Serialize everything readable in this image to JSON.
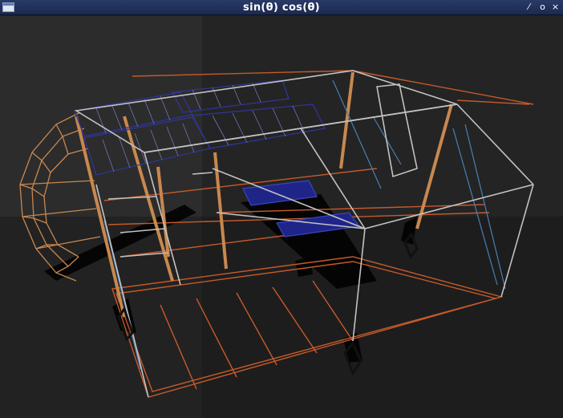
{
  "window": {
    "title": "sin(θ) cos(θ)",
    "controls": {
      "minimize_glyph": "⁄",
      "maximize_glyph": "o",
      "close_glyph": "×"
    }
  },
  "scene": {
    "background_colors": [
      "#2a2a2a",
      "#242424",
      "#1c1c1c"
    ],
    "wire_colors": {
      "frame": "#b9b9b9",
      "orange": "#c65a2a",
      "tan": "#c8884f",
      "blue": "#4a6fb0",
      "navy": "#2a2f8a",
      "shadow": "#000000"
    }
  }
}
